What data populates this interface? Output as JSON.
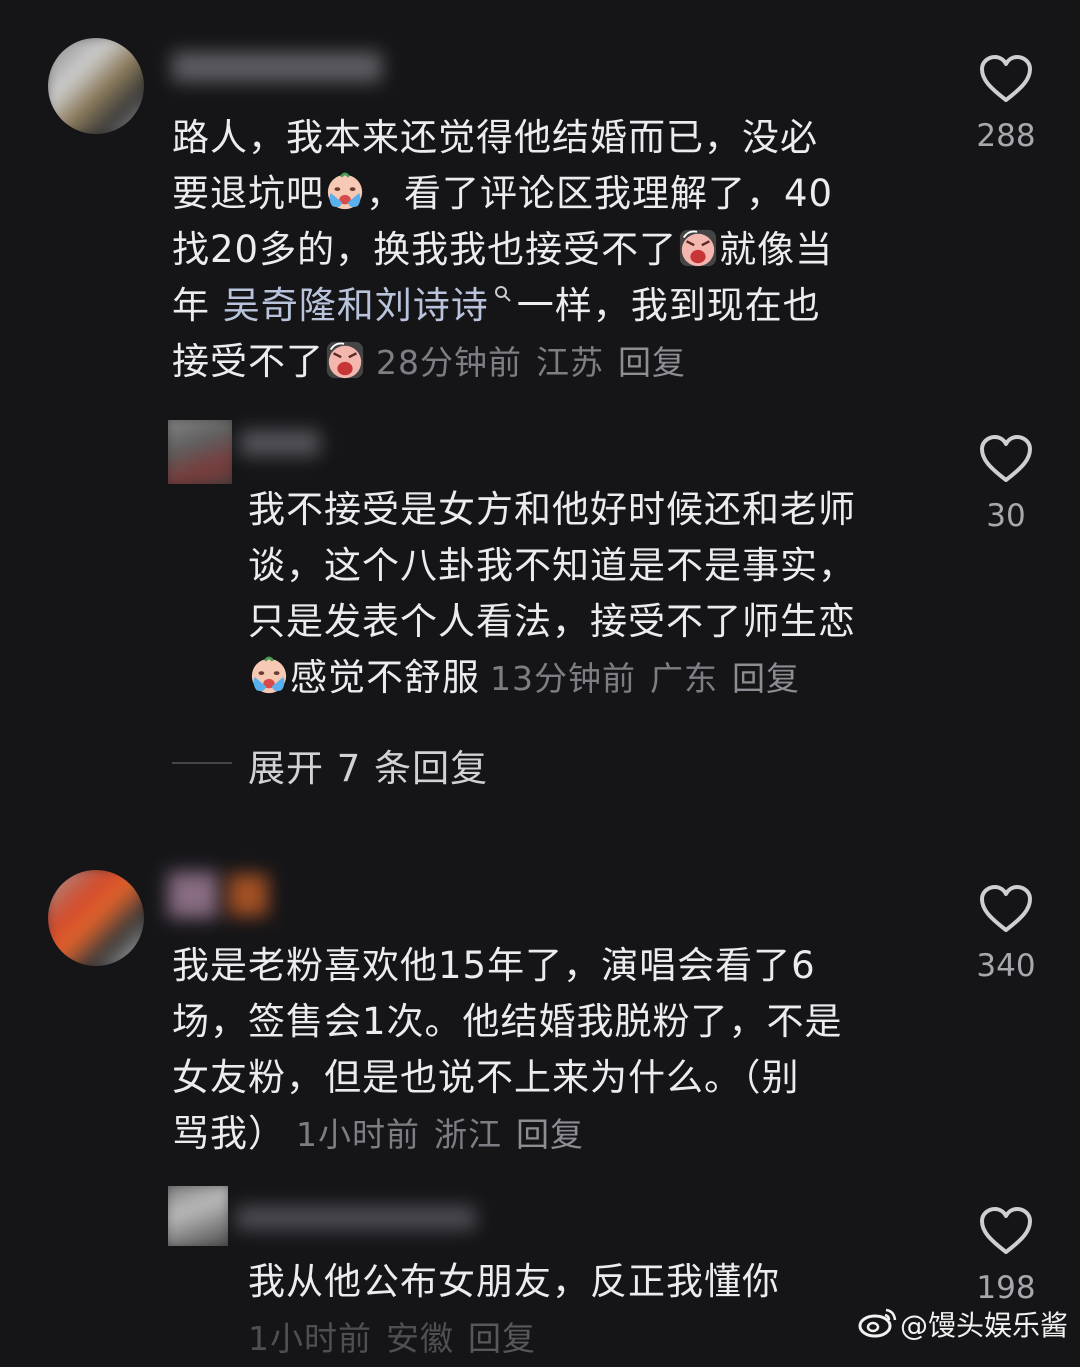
{
  "comments": [
    {
      "lines": [
        "路人，我本来还觉得他结婚而已，没必",
        "要退坑吧",
        "，看了评论区我理解了，40",
        "找20多的，换我我也接受不了",
        "就像当",
        "年 ",
        "吴奇隆和刘诗诗",
        "一样，我到现在也",
        "接受不了"
      ],
      "time": "28分钟前",
      "location": "江苏",
      "reply_label": "回复",
      "likes": "288"
    },
    {
      "lines": [
        "我不接受是女方和他好时候还和老师",
        "谈，这个八卦我不知道是不是事实，",
        "只是发表个人看法，接受不了师生恋",
        "感觉不舒服"
      ],
      "time": "13分钟前",
      "location": "广东",
      "reply_label": "回复",
      "likes": "30"
    },
    {
      "lines": [
        "我是老粉喜欢他15年了，演唱会看了6",
        "场，签售会1次。他结婚我脱粉了，不是",
        "女友粉，但是也说不上来为什么。（别",
        "骂我）"
      ],
      "time": "1小时前",
      "location": "浙江",
      "reply_label": "回复",
      "likes": "340"
    },
    {
      "lines": [
        "我从他公布女朋友，反正我懂你"
      ],
      "time": "1小时前",
      "location": "安徽",
      "reply_label": "回复",
      "likes": "198"
    }
  ],
  "expand_replies": "展开 7 条回复",
  "watermark": "@馒头娱乐酱",
  "icons": {
    "like": "heart-outline-icon",
    "search": "search-icon",
    "weibo": "weibo-logo-icon"
  },
  "colors": {
    "background": "#151518",
    "text": "#ececef",
    "meta": "#7d7d84"
  }
}
